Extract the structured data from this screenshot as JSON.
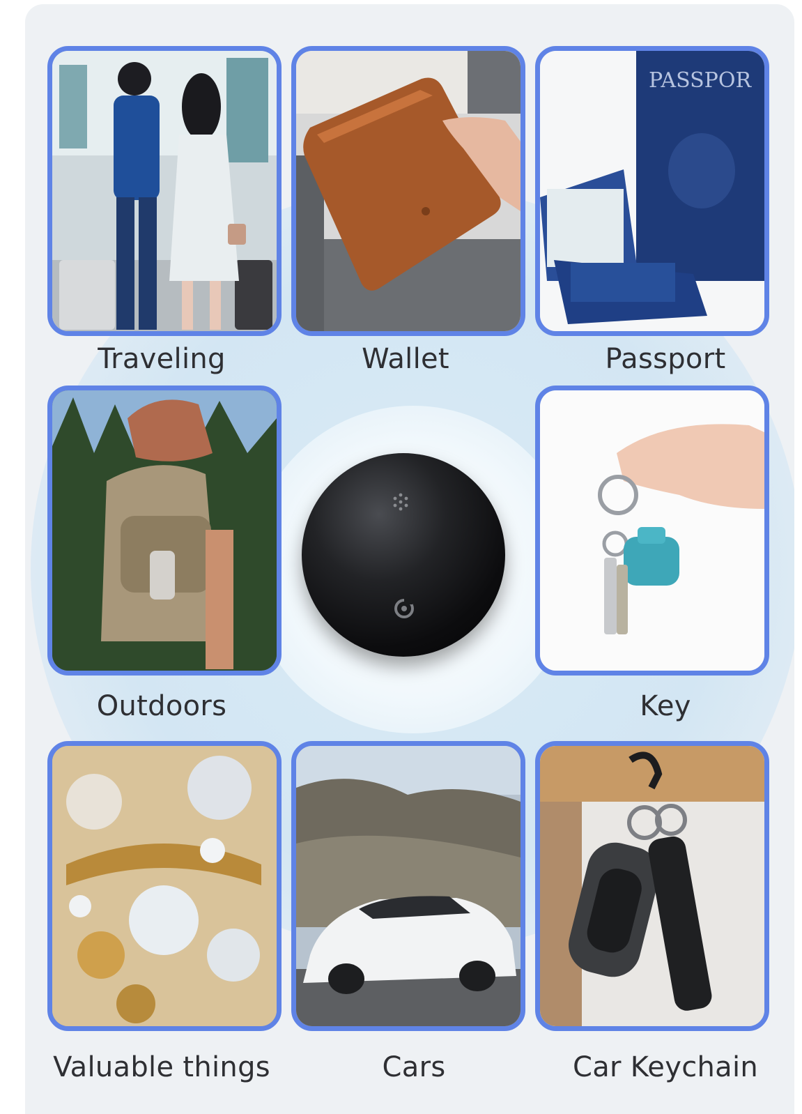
{
  "categories": [
    {
      "label": "Traveling",
      "image": "couple-with-suitcases-photo"
    },
    {
      "label": "Wallet",
      "image": "leather-wallet-photo"
    },
    {
      "label": "Passport",
      "image": "passport-photo"
    },
    {
      "label": "Outdoors",
      "image": "hiker-backpack-photo"
    },
    {
      "label": "Key",
      "image": "hand-holding-keys-photo"
    },
    {
      "label": "Valuable things",
      "image": "jewelry-photo"
    },
    {
      "label": "Cars",
      "image": "white-car-photo"
    },
    {
      "label": "Car Keychain",
      "image": "car-key-fob-photo"
    }
  ],
  "product": {
    "image": "black-round-tracker",
    "icons": [
      "speaker-holes-icon",
      "logo-icon"
    ]
  },
  "colors": {
    "frame": "#5f83e6",
    "background": "#eef1f4",
    "halo": "#d6e8f4",
    "text": "#2e2f33"
  }
}
